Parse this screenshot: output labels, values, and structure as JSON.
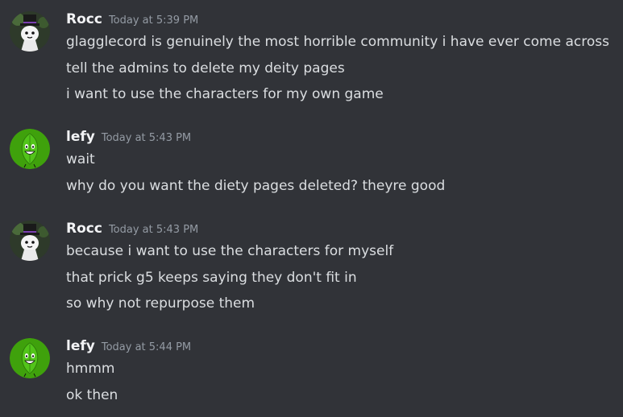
{
  "colors": {
    "background": "#313338",
    "username": "#f2f3f5",
    "message_text": "#dbdee1",
    "timestamp": "#949ba4",
    "lefy_avatar_bg": "#3fa10c"
  },
  "messages": [
    {
      "username": "Rocc",
      "timestamp": "Today at 5:39 PM",
      "avatar_icon": "rocc-avatar-icon",
      "lines": [
        "glagglecord is genuinely the most horrible community i have ever come across",
        "tell the admins to delete my deity pages",
        "i want to use the characters for my own game"
      ]
    },
    {
      "username": "lefy",
      "timestamp": "Today at 5:43 PM",
      "avatar_icon": "leafy-avatar-icon",
      "lines": [
        "wait",
        "why do you want the diety pages deleted? theyre good"
      ]
    },
    {
      "username": "Rocc",
      "timestamp": "Today at 5:43 PM",
      "avatar_icon": "rocc-avatar-icon",
      "lines": [
        "because i want to use the characters for myself",
        "that prick g5 keeps saying they don't fit in",
        "so why not repurpose them"
      ]
    },
    {
      "username": "lefy",
      "timestamp": "Today at 5:44 PM",
      "avatar_icon": "leafy-avatar-icon",
      "lines": [
        "hmmm",
        "ok then"
      ]
    }
  ]
}
